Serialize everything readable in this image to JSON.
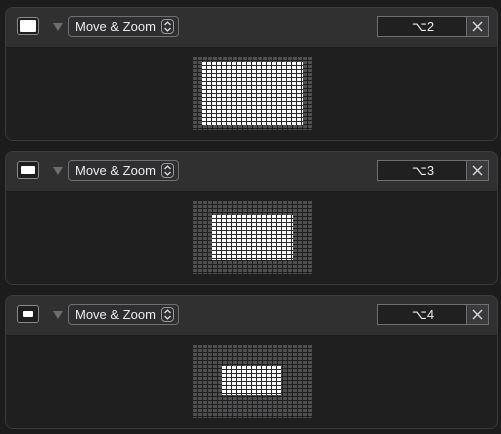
{
  "panels": [
    {
      "mode_label": "Move & Zoom",
      "shortcut": "⌥2",
      "size_fraction": 0.85
    },
    {
      "mode_label": "Move & Zoom",
      "shortcut": "⌥3",
      "size_fraction": 0.68
    },
    {
      "mode_label": "Move & Zoom",
      "shortcut": "⌥4",
      "size_fraction": 0.5
    }
  ],
  "icons": {
    "disclosure": "disclosure-triangle-icon",
    "chevron": "up-down-chevron-icon",
    "close": "close-x-icon",
    "size": "window-size-icon"
  },
  "colors": {
    "background": "#1c1c1d",
    "panel": "#2a2a2b",
    "active_cell": "#ffffff",
    "inactive_cell": "#4f4f51"
  }
}
